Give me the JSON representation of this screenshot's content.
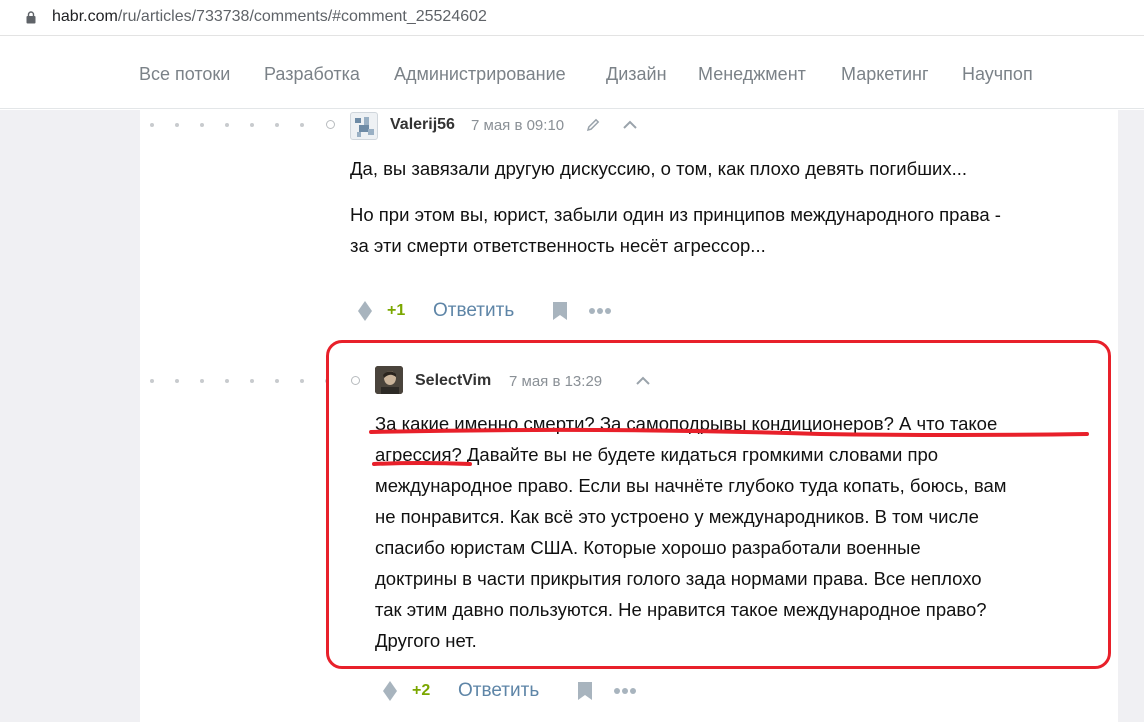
{
  "browser": {
    "url_host": "habr.com",
    "url_path": "/ru/articles/733738/comments/#comment_25524602"
  },
  "nav": {
    "items": [
      "Все потоки",
      "Разработка",
      "Администрирование",
      "Дизайн",
      "Менеджмент",
      "Маркетинг",
      "Научпоп"
    ]
  },
  "comments": [
    {
      "author": "Valerij56",
      "time": "7 мая в 09:10",
      "paragraphs": [
        "Да, вы завязали другую дискуссию, о том, как плохо девять погибших...",
        "Но при этом вы, юрист, забыли один из принципов международного права -",
        "за эти смерти ответственность несёт агрессор..."
      ],
      "votes": "+1",
      "reply_label": "Ответить"
    },
    {
      "author": "SelectVim",
      "time": "7 мая в 13:29",
      "lines": [
        "За какие именно смерти? За самоподрывы кондиционеров? А что такое",
        "агрессия? Давайте вы не будете кидаться громкими словами про",
        "международное право. Если вы начнёте глубоко туда копать, боюсь, вам",
        "не понравится. Как всё это устроено у международников. В том числе",
        "спасибо юристам США. Которые хорошо разработали военные",
        "доктрины в части прикрытия голого зада нормами права. Все неплохо",
        "так этим давно пользуются. Не нравится такое международное право?",
        "Другого нет."
      ],
      "votes": "+2",
      "reply_label": "Ответить"
    }
  ],
  "colors": {
    "annotation": "#e8202a",
    "vote_positive": "#7ba700",
    "link": "#5e85a7"
  }
}
